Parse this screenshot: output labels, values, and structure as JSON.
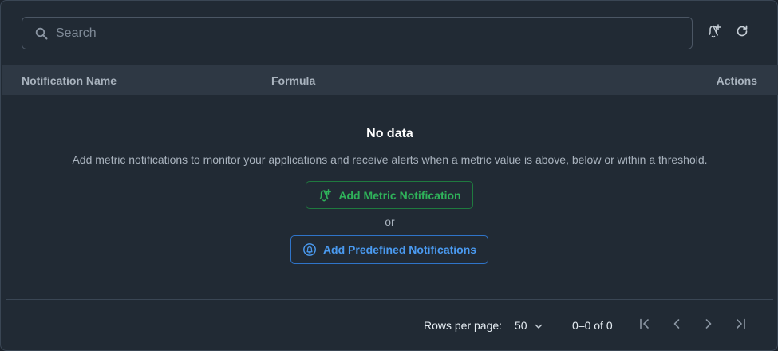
{
  "search": {
    "placeholder": "Search",
    "value": ""
  },
  "toolbar": {
    "add_icon": "bell-plus-icon",
    "refresh_icon": "refresh-icon"
  },
  "table": {
    "columns": [
      "Notification Name",
      "Formula",
      "Actions"
    ],
    "rows": []
  },
  "empty_state": {
    "title": "No data",
    "description": "Add metric notifications to monitor your applications and receive alerts when a metric value is above, below or within a threshold.",
    "add_metric_label": "Add Metric Notification",
    "or_label": "or",
    "add_predefined_label": "Add Predefined Notifications"
  },
  "pagination": {
    "rows_per_page_label": "Rows per page:",
    "rows_per_page_value": "50",
    "range": "0–0 of 0"
  },
  "colors": {
    "background": "#212a34",
    "header_bg": "#2e3844",
    "green": "#2fb25a",
    "blue": "#4a9af0"
  }
}
